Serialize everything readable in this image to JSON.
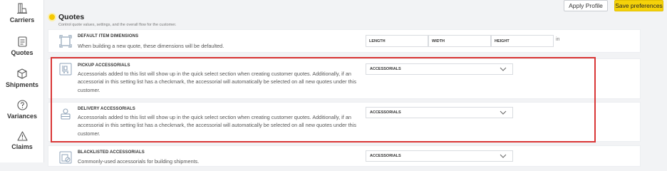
{
  "sidebar": {
    "items": [
      {
        "label": "Carriers",
        "icon": "carriers-icon"
      },
      {
        "label": "Quotes",
        "icon": "quotes-icon"
      },
      {
        "label": "Shipments",
        "icon": "shipments-icon"
      },
      {
        "label": "Variances",
        "icon": "variances-icon"
      },
      {
        "label": "Claims",
        "icon": "claims-icon"
      }
    ]
  },
  "toolbar": {
    "apply_label": "Apply Profile",
    "save_label": "Save preferences"
  },
  "section": {
    "title": "Quotes",
    "subtitle": "Control quote values, settings, and the overall flow for the customer."
  },
  "rows": {
    "default_dims": {
      "title": "DEFAULT ITEM DIMENSIONS",
      "desc": "When building a new quote, these dimensions will be defaulted.",
      "length_label": "LENGTH",
      "width_label": "WIDTH",
      "height_label": "HEIGHT",
      "unit": "in"
    },
    "pickup": {
      "title": "PICKUP ACCESSORIALS",
      "desc": "Accessorials added to this list will show up in the quick select section when creating customer quotes. Additionally, if an accessorial in this setting list has a checkmark, the accessorial will automatically be selected on all new quotes under this customer.",
      "select_label": "ACCESSORIALS"
    },
    "delivery": {
      "title": "DELIVERY ACCESSORIALS",
      "desc": "Accessorials added to this list will show up in the quick select section when creating customer quotes. Additionally, if an accessorial in this setting list has a checkmark, the accessorial will automatically be selected on all new quotes under this customer.",
      "select_label": "ACCESSORIALS"
    },
    "blacklisted": {
      "title": "BLACKLISTED ACCESSORIALS",
      "desc": "Commonly-used accessorials for building shipments.",
      "select_label": "ACCESSORIALS"
    }
  },
  "colors": {
    "accent": "#f5d20a",
    "highlight": "#d93636",
    "icon": "#8fa3b8"
  }
}
